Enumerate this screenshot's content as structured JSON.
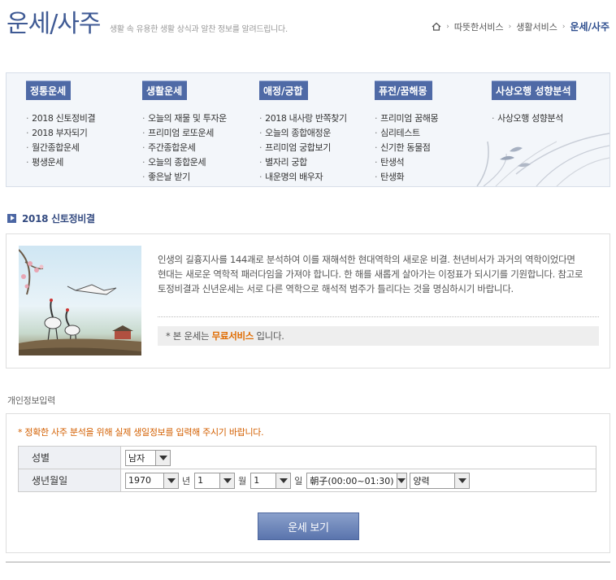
{
  "header": {
    "title": "운세/사주",
    "subtitle": "생활 속 유용한 생활 상식과 알찬 정보를 알려드립니다.",
    "breadcrumb": [
      "따뜻한서비스",
      "생활서비스",
      "운세/사주"
    ]
  },
  "menu": [
    {
      "heading": "정통운세",
      "items": [
        "2018 신토정비결",
        "2018 부자되기",
        "월간종합운세",
        "평생운세"
      ]
    },
    {
      "heading": "생활운세",
      "items": [
        "오늘의 재물 및 투자운",
        "프리미엄 로또운세",
        "주간종합운세",
        "오늘의 종합운세",
        "좋은날 받기"
      ]
    },
    {
      "heading": "애정/궁합",
      "items": [
        "2018 내사랑 반쪽찾기",
        "오늘의 종합애정운",
        "프리미엄 궁합보기",
        "별자리 궁합",
        "내운명의 배우자"
      ]
    },
    {
      "heading": "퓨전/꿈해몽",
      "items": [
        "프리미엄 꿈해몽",
        "심리테스트",
        "신기한 동물점",
        "탄생석",
        "탄생화"
      ]
    },
    {
      "heading": "사상오행 성향분석",
      "items": [
        "사상오행 성향분석"
      ]
    }
  ],
  "section": {
    "title": "2018 신토정비결",
    "description": "인생의 길흉지사를 144괘로 분석하여 이를 재해석한 현대역학의 새로운 비결. 천년비서가 과거의 역학이었다면 현대는 새로운 역학적 패러다임을 가져야 합니다. 한 해를 새롭게 살아가는 이정표가 되시기를 기원합니다. 참고로 토정비결과 신년운세는 서로 다른 역학으로 해석적 범주가 틀리다는 것을 명심하시기 바랍니다.",
    "note_prefix": "* 본 운세는 ",
    "note_highlight": "무료서비스",
    "note_suffix": " 입니다."
  },
  "personal_info": {
    "label": "개인정보입력",
    "notice": "* 정확한 사주 분석을 위해 실제 생일정보를 입력해 주시기 바랍니다.",
    "gender_label": "성별",
    "gender_value": "남자",
    "birth_label": "생년월일",
    "year_value": "1970",
    "year_unit": "년",
    "month_value": "1",
    "month_unit": "월",
    "day_value": "1",
    "day_unit": "일",
    "time_value": "朝子(00:00~01:30)",
    "calendar_value": "양력",
    "submit_label": "운세 보기"
  },
  "colors": {
    "accent": "#4f6aa6",
    "highlight": "#e06b00",
    "notice": "#d35f00"
  }
}
